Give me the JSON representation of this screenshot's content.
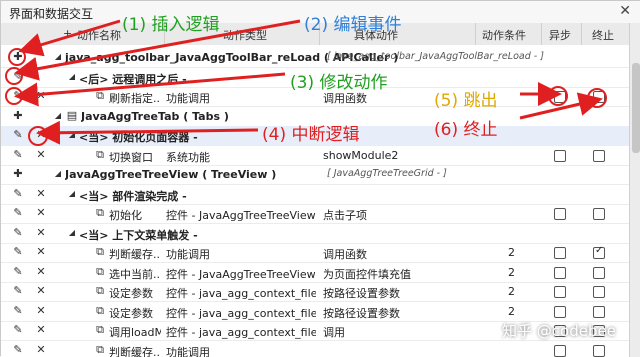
{
  "window": {
    "title": "界面和数据交互",
    "close_glyph": "✕"
  },
  "header": {
    "plus_glyph": "+",
    "columns": [
      "动作名称",
      "动作类型",
      "具体动作",
      "动作条件",
      "异步",
      "终止"
    ]
  },
  "annotations": {
    "insert": "(1) 插入逻辑",
    "edit_event": "(2) 编辑事件",
    "modify": "(3) 修改动作",
    "interrupt": "(4) 中断逻辑",
    "jump_out": "(5) 跳出",
    "terminate": "(6) 终止",
    "colors": {
      "red": "#e02020",
      "green": "#22a022",
      "blue": "#2f7fd6",
      "yellow": "#e0a800"
    }
  },
  "rows": [
    {
      "ctrl": "plus",
      "expand": "◢",
      "indent": 0,
      "icon": "",
      "name": "java_agg_toolbar_JavaAggToolBar_reLoad ( APICaller )",
      "suffix": "[ java_agg_toolbar_JavaAggToolBar_reLoad - ]",
      "group": true
    },
    {
      "ctrl": "edit",
      "expand": "◢",
      "indent": 1,
      "icon": "",
      "name": "<后> 远程调用之后 -",
      "suffix": "",
      "group": true
    },
    {
      "ctrl": "edit",
      "x": "✕",
      "expand": "",
      "indent": 2,
      "icon": "⧉",
      "name": "刷新指定...",
      "type": "功能调用",
      "action": "调用函数",
      "cond": "",
      "async": false,
      "stop": false
    },
    {
      "ctrl": "plus",
      "expand": "◢",
      "indent": 0,
      "icon": "▤",
      "name": "JavaAggTreeTab ( Tabs )",
      "suffix": "",
      "group": true
    },
    {
      "ctrl": "edit",
      "x": "✕",
      "expand": "◢",
      "indent": 1,
      "icon": "",
      "name": "<当> 初始化页面容器 -",
      "suffix": "",
      "group": true,
      "sel": true
    },
    {
      "ctrl": "edit",
      "x": "✕",
      "expand": "",
      "indent": 2,
      "icon": "⧉",
      "name": "切换窗口",
      "type": "系统功能",
      "action": "showModule2",
      "cond": "",
      "async": false,
      "stop": false
    },
    {
      "ctrl": "plus",
      "expand": "◢",
      "indent": 0,
      "icon": "",
      "name": "JavaAggTreeTreeView ( TreeView )",
      "suffix": "[ JavaAggTreeTreeGrid - ]",
      "group": true
    },
    {
      "ctrl": "edit",
      "x": "✕",
      "expand": "◢",
      "indent": 1,
      "icon": "",
      "name": "<当> 部件渲染完成 -",
      "suffix": "",
      "group": true
    },
    {
      "ctrl": "edit",
      "x": "✕",
      "expand": "",
      "indent": 2,
      "icon": "⧉",
      "name": "初始化",
      "type": "控件 - JavaAggTreeTreeView",
      "action": "点击子项",
      "cond": "",
      "async": false,
      "stop": false
    },
    {
      "ctrl": "edit",
      "x": "✕",
      "expand": "◢",
      "indent": 1,
      "icon": "",
      "name": "<当> 上下文菜单触发 -",
      "suffix": "",
      "group": true
    },
    {
      "ctrl": "edit",
      "x": "✕",
      "expand": "",
      "indent": 2,
      "icon": "⧉",
      "name": "判断缓存...",
      "type": "功能调用",
      "action": "调用函数",
      "cond": "2",
      "async": false,
      "stop": true
    },
    {
      "ctrl": "edit",
      "x": "✕",
      "expand": "",
      "indent": 2,
      "icon": "⧉",
      "name": "选中当前...",
      "type": "控件 - JavaAggTreeTreeView",
      "action": "为页面控件填充值",
      "cond": "2",
      "async": false,
      "stop": false
    },
    {
      "ctrl": "edit",
      "x": "✕",
      "expand": "",
      "indent": 2,
      "icon": "⧉",
      "name": "设定参数",
      "type": "控件 - java_agg_context_file_Java...",
      "action": "按路径设置参数",
      "cond": "2",
      "async": false,
      "stop": false
    },
    {
      "ctrl": "edit",
      "x": "✕",
      "expand": "",
      "indent": 2,
      "icon": "⧉",
      "name": "设定参数",
      "type": "控件 - java_agg_context_file_Java...",
      "action": "按路径设置参数",
      "cond": "2",
      "async": false,
      "stop": false
    },
    {
      "ctrl": "edit",
      "x": "✕",
      "expand": "",
      "indent": 2,
      "icon": "⧉",
      "name": "调用loadM...",
      "type": "控件 - java_agg_context_file_Java...",
      "action": "调用",
      "cond": "",
      "async": false,
      "stop": false
    },
    {
      "ctrl": "edit",
      "x": "✕",
      "expand": "",
      "indent": 2,
      "icon": "⧉",
      "name": "判断缓存...",
      "type": "功能调用",
      "action": "",
      "cond": "",
      "async": false,
      "stop": false
    }
  ],
  "watermark": "知乎 @codebee"
}
